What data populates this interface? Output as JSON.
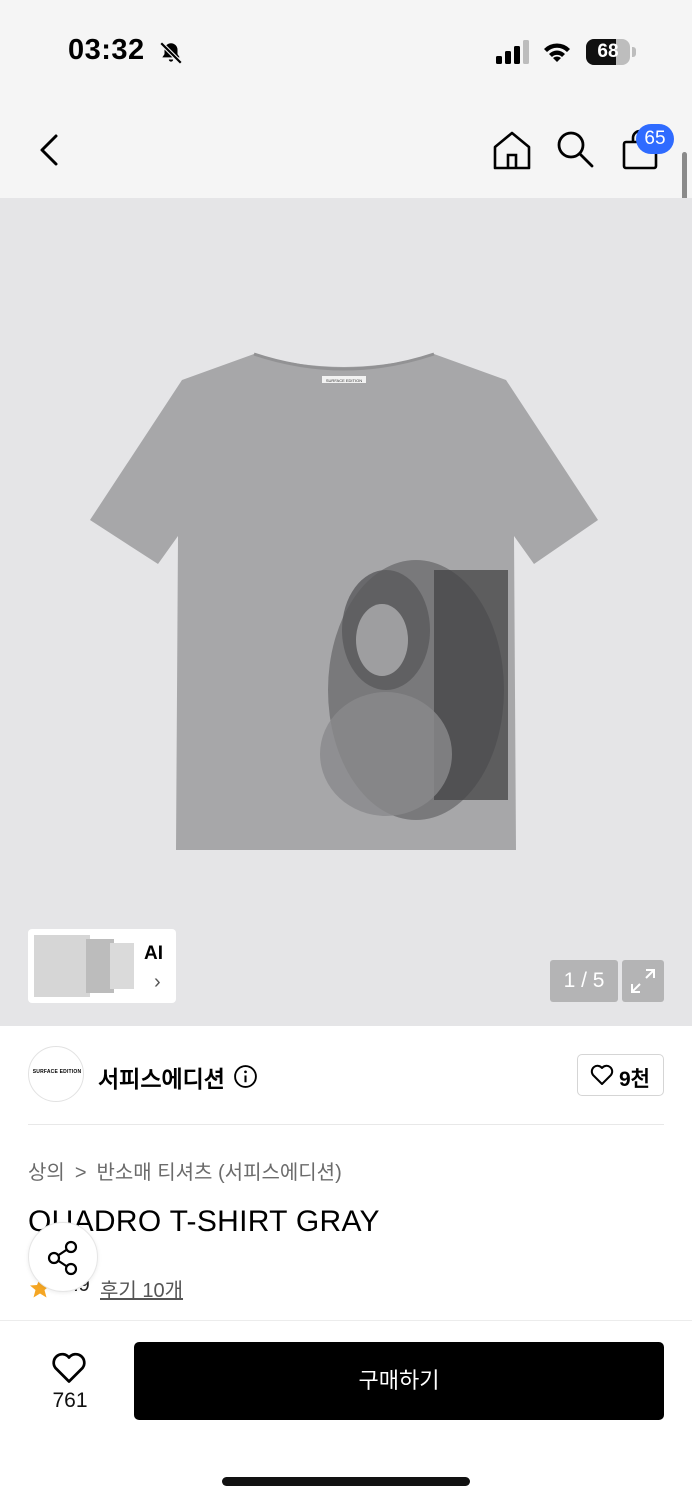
{
  "status_bar": {
    "time": "03:32",
    "battery": "68",
    "battery_level": 0.68
  },
  "nav": {
    "icons": [
      "back-icon",
      "home-icon",
      "search-icon",
      "cart-icon"
    ],
    "cart_badge": "65"
  },
  "gallery": {
    "thumbnail_label": "AI",
    "thumbnail_chevron": "›",
    "counter": "1 / 5",
    "shirt_tag": "SURFACE EDITION"
  },
  "brand": {
    "logo_text": "SURFACE EDITION",
    "name": "서피스에디션",
    "like_count": "9천"
  },
  "breadcrumb": {
    "items": [
      "상의",
      "반소매 티셔츠 (서피스에디션)"
    ],
    "separator": ">"
  },
  "product": {
    "title": "QUADRO T-SHIRT GRAY",
    "rating": "4.9",
    "reviews_label": "후기 10개"
  },
  "bottom_bar": {
    "like_count": "761",
    "buy_label": "구매하기"
  },
  "colors": {
    "badge": "#2f6bff",
    "star": "#f5a623",
    "buy_button": "#000000"
  }
}
